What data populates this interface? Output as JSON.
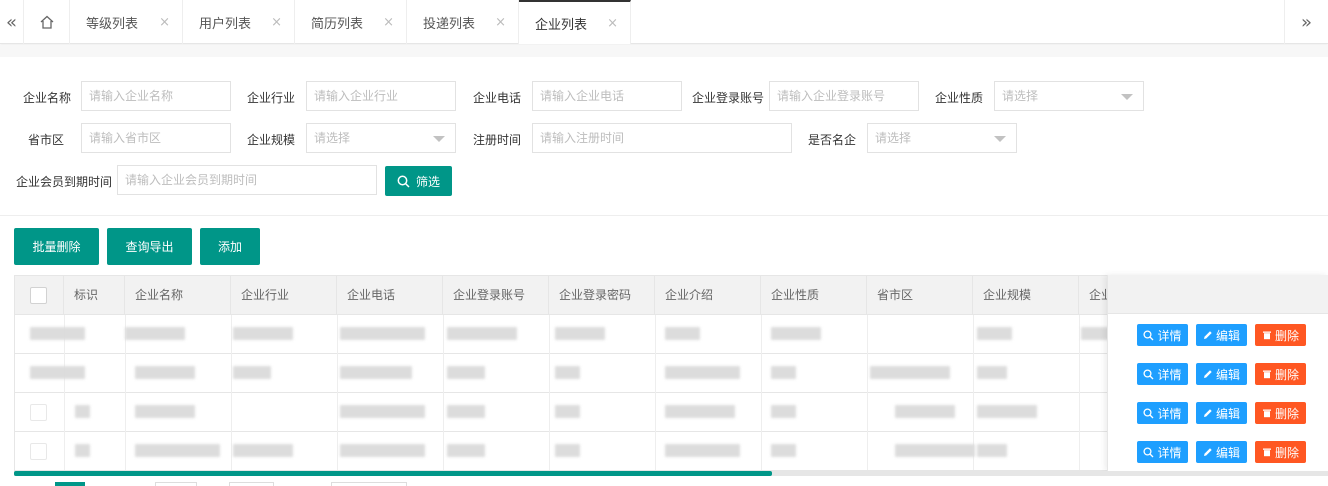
{
  "tabs": {
    "left_arrow": "«",
    "right_arrow": "»",
    "home_icon": "home-icon",
    "items": [
      {
        "label": "等级列表",
        "close": "×"
      },
      {
        "label": "用户列表",
        "close": "×"
      },
      {
        "label": "简历列表",
        "close": "×"
      },
      {
        "label": "投递列表",
        "close": "×"
      },
      {
        "label": "企业列表",
        "close": "×",
        "active": true
      }
    ]
  },
  "filters": {
    "company_name": {
      "label": "企业名称",
      "placeholder": "请输入企业名称"
    },
    "industry": {
      "label": "企业行业",
      "placeholder": "请输入企业行业"
    },
    "phone": {
      "label": "企业电话",
      "placeholder": "请输入企业电话"
    },
    "login_account": {
      "label": "企业登录账号",
      "placeholder": "请输入企业登录账号"
    },
    "nature": {
      "label": "企业性质",
      "placeholder": "请选择"
    },
    "region": {
      "label": "省市区",
      "placeholder": "请输入省市区"
    },
    "scale": {
      "label": "企业规模",
      "placeholder": "请选择"
    },
    "register_time": {
      "label": "注册时间",
      "placeholder": "请输入注册时间"
    },
    "famous": {
      "label": "是否名企",
      "placeholder": "请选择"
    },
    "member_expire": {
      "label": "企业会员到期时间",
      "placeholder": "请输入企业会员到期时间"
    },
    "search_button": "筛选"
  },
  "toolbar": {
    "batch_delete": "批量删除",
    "export": "查询导出",
    "add": "添加"
  },
  "table": {
    "headers": [
      "标识",
      "企业名称",
      "企业行业",
      "企业电话",
      "企业登录账号",
      "企业登录密码",
      "企业介绍",
      "企业性质",
      "省市区",
      "企业规模",
      "企业"
    ],
    "row_count": 4,
    "actions": {
      "detail": "详情",
      "edit": "编辑",
      "delete": "删除"
    }
  },
  "colors": {
    "accent": "#009688",
    "blue": "#1e9fff",
    "red": "#ff5722"
  }
}
